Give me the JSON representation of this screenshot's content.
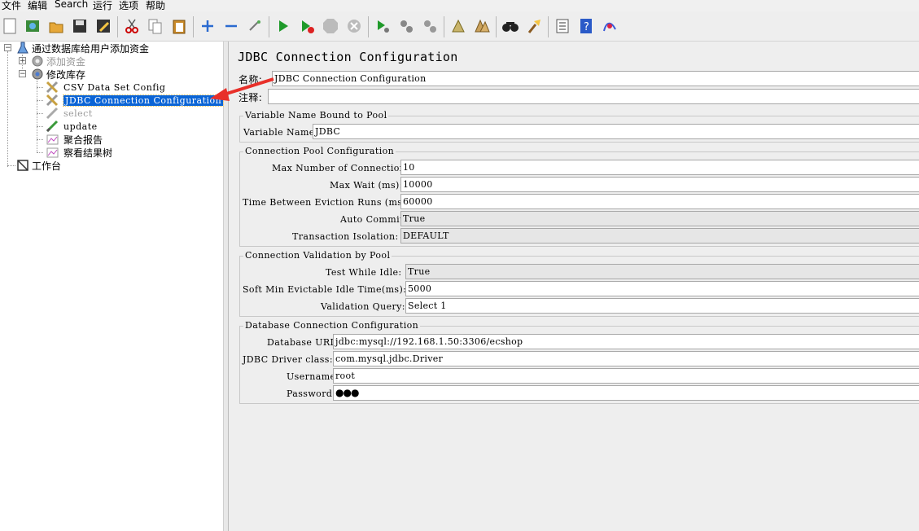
{
  "menu": [
    "文件",
    "编辑",
    "Search",
    "运行",
    "选项",
    "帮助"
  ],
  "toolbar_icons": [
    "new-icon",
    "templates-icon",
    "open-icon",
    "save-icon",
    "save-as-icon",
    "cut-icon",
    "copy-icon",
    "paste-icon",
    "expand-icon",
    "collapse-icon",
    "toggle-icon",
    "start-icon",
    "start-no-pause-icon",
    "stop-icon",
    "shutdown-icon",
    "remote-start-icon",
    "remote-stop-icon",
    "remote-shutdown-icon",
    "clear-icon",
    "clear-all-icon",
    "search-icon",
    "reset-search-icon",
    "function-helper-icon",
    "help-icon",
    "log-viewer-icon"
  ],
  "tree": {
    "test_plan": "通过数据库给用户添加资金",
    "group1": "添加资金",
    "group2": "修改库存",
    "csv": "CSV Data Set Config",
    "jdbc": "JDBC Connection Configuration",
    "select": "select",
    "update": "update",
    "agg": "聚合报告",
    "tree_result": "察看结果树",
    "workbench": "工作台"
  },
  "panel": {
    "title": "JDBC Connection Configuration",
    "name_label": "名称:",
    "name_value": "JDBC Connection Configuration",
    "comment_label": "注释:",
    "comment_value": ""
  },
  "var_group": {
    "title": "Variable Name Bound to Pool",
    "var_label": "Variable Name:",
    "var_value": "JDBC"
  },
  "pool_group": {
    "title": "Connection Pool Configuration",
    "max_conn_label": "Max Number of Connections:",
    "max_conn_value": "10",
    "max_wait_label": "Max Wait (ms):",
    "max_wait_value": "10000",
    "eviction_label": "Time Between Eviction Runs (ms):",
    "eviction_value": "60000",
    "auto_commit_label": "Auto Commit:",
    "auto_commit_value": "True",
    "isolation_label": "Transaction Isolation:",
    "isolation_value": "DEFAULT"
  },
  "validation_group": {
    "title": "Connection Validation by Pool",
    "test_idle_label": "Test While Idle:",
    "test_idle_value": "True",
    "soft_min_label": "Soft Min Evictable Idle Time(ms):",
    "soft_min_value": "5000",
    "query_label": "Validation Query:",
    "query_value": "Select 1"
  },
  "db_group": {
    "title": "Database Connection Configuration",
    "url_label": "Database URL:",
    "url_value": "jdbc:mysql://192.168.1.50:3306/ecshop",
    "driver_label": "JDBC Driver class:",
    "driver_value": "com.mysql.jdbc.Driver",
    "user_label": "Username:",
    "user_value": "root",
    "pass_label": "Password:",
    "pass_value": "●●●"
  },
  "colors": {
    "selection": "#0a64d6",
    "arrow": "#e8302a"
  }
}
